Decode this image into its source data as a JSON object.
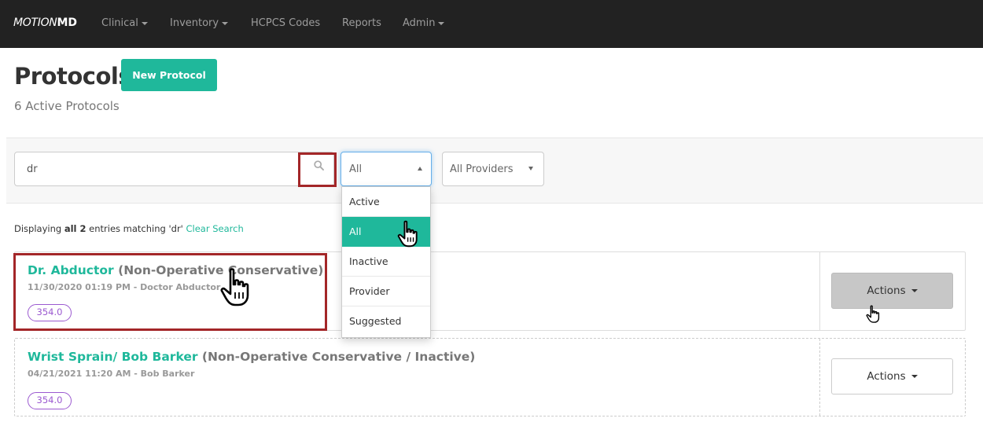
{
  "navbar": {
    "brand_part1": "MOTION",
    "brand_part2": "MD",
    "items": [
      {
        "label": "Clinical",
        "has_caret": true
      },
      {
        "label": "Inventory",
        "has_caret": true
      },
      {
        "label": "HCPCS Codes",
        "has_caret": false
      },
      {
        "label": "Reports",
        "has_caret": false
      },
      {
        "label": "Admin",
        "has_caret": true
      }
    ]
  },
  "header": {
    "title": "Protocols",
    "new_button": "New Protocol",
    "subtitle": "6 Active Protocols"
  },
  "filters": {
    "search_value": "dr",
    "status_selected": "All",
    "provider_selected": "All Providers",
    "status_options": [
      "Active",
      "All",
      "Inactive",
      "Provider",
      "Suggested"
    ]
  },
  "results": {
    "prefix": "Displaying",
    "count": "all 2",
    "middle": "entries matching",
    "query": "'dr'",
    "clear_link": "Clear Search"
  },
  "protocols": [
    {
      "name": "Dr. Abductor",
      "type": "(Non-Operative Conservative)",
      "meta": "11/30/2020 01:19 PM - Doctor Abductor",
      "code": "354.0",
      "actions": "Actions"
    },
    {
      "name": "Wrist Sprain/ Bob Barker",
      "type": "(Non-Operative Conservative / Inactive)",
      "meta": "04/21/2021 11:20 AM - Bob Barker",
      "code": "354.0",
      "actions": "Actions"
    }
  ],
  "colors": {
    "navbar_bg": "#222222",
    "accent": "#1fb89b",
    "badge": "#9b59d0",
    "highlight": "#a32628"
  },
  "icons": [
    "search-icon",
    "chevron-down-icon",
    "chevron-up-icon",
    "hand-pointer-cursor-icon"
  ]
}
